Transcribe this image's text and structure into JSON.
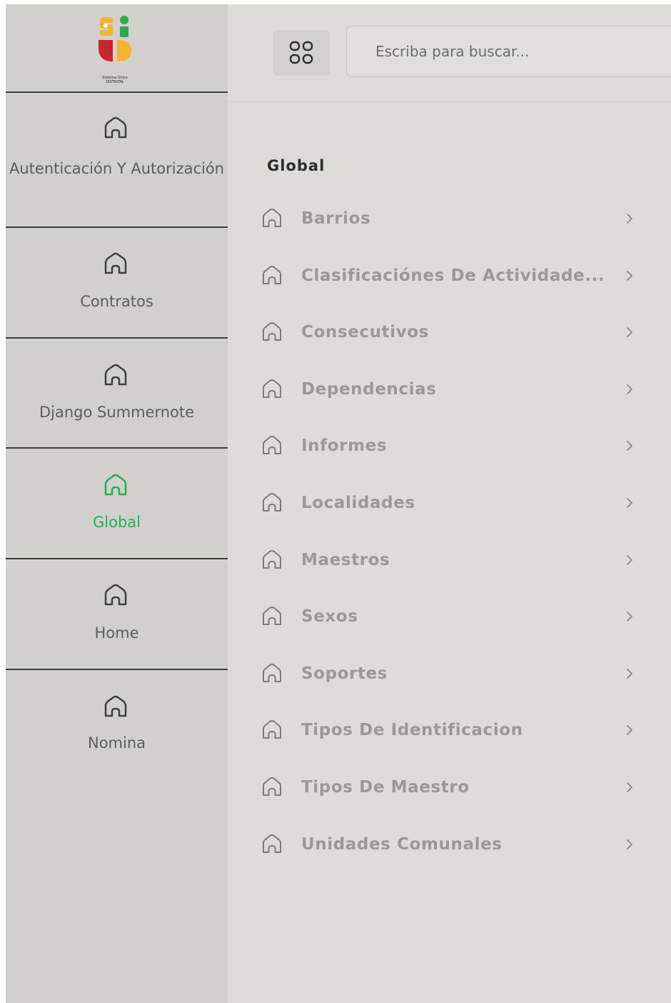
{
  "logo": {
    "caption_line1": "Sistema Único",
    "caption_line2": "DISTRITAL",
    "colors": {
      "red": "#c8252c",
      "yellow": "#f3b52b",
      "green": "#2ea84a"
    }
  },
  "sidebar": {
    "items": [
      {
        "label": "Autenticación Y Autorización",
        "icon": "home-icon",
        "active": false
      },
      {
        "label": "Contratos",
        "icon": "home-icon",
        "active": false
      },
      {
        "label": "Django Summernote",
        "icon": "home-icon",
        "active": false
      },
      {
        "label": "Global",
        "icon": "home-icon",
        "active": true
      },
      {
        "label": "Home",
        "icon": "home-icon",
        "active": false
      },
      {
        "label": "Nomina",
        "icon": "home-icon",
        "active": false
      }
    ]
  },
  "header": {
    "apps_icon": "grid-icon",
    "search": {
      "placeholder": "Escriba para buscar..."
    }
  },
  "menu": {
    "title": "Global",
    "items": [
      {
        "label": "Barrios"
      },
      {
        "label": "Clasificaciónes De Actividade..."
      },
      {
        "label": "Consecutivos"
      },
      {
        "label": "Dependencias"
      },
      {
        "label": "Informes"
      },
      {
        "label": "Localidades"
      },
      {
        "label": "Maestros"
      },
      {
        "label": "Sexos"
      },
      {
        "label": "Soportes"
      },
      {
        "label": "Tipos De Identificacion"
      },
      {
        "label": "Tipos De Maestro"
      },
      {
        "label": "Unidades Comunales"
      }
    ]
  },
  "colors": {
    "active": "#23b14d",
    "sidebar_bg": "#d1d0cd",
    "main_bg": "#dddcd9",
    "menu_text": "#9b9896"
  }
}
